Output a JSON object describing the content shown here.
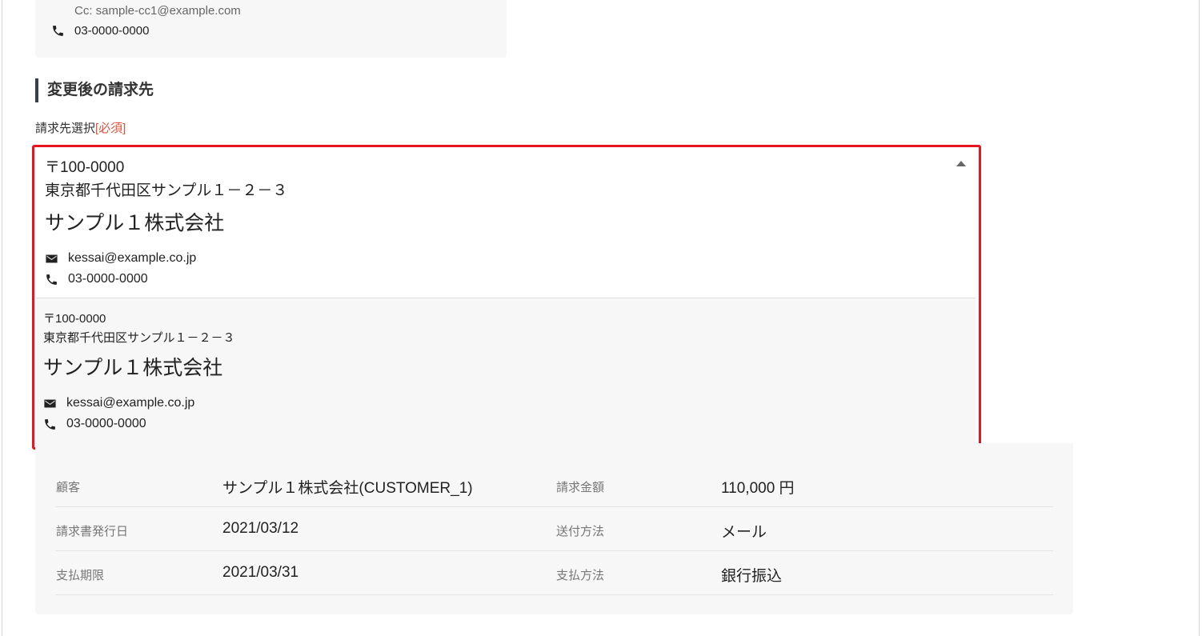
{
  "previous_billing": {
    "cc": "Cc: sample-cc1@example.com",
    "phone": "03-0000-0000"
  },
  "section": {
    "title": "変更後の請求先"
  },
  "billing_select": {
    "label": "請求先選択",
    "required": "[必須]",
    "selected": {
      "zip": "〒100-0000",
      "address": "東京都千代田区サンプル１－２－３",
      "company": "サンプル１株式会社",
      "email": "kessai@example.co.jp",
      "phone": "03-0000-0000"
    },
    "options": [
      {
        "zip": "〒100-0000",
        "address": "東京都千代田区サンプル１－２－３",
        "company": "サンプル１株式会社",
        "email": "kessai@example.co.jp",
        "phone": "03-0000-0000"
      }
    ]
  },
  "summary": {
    "rows": [
      {
        "k1": "顧客",
        "v1": "サンプル１株式会社(CUSTOMER_1)",
        "k2": "請求金額",
        "v2": "110,000 円"
      },
      {
        "k1": "請求書発行日",
        "v1": "2021/03/12",
        "k2": "送付方法",
        "v2": "メール"
      },
      {
        "k1": "支払期限",
        "v1": "2021/03/31",
        "k2": "支払方法",
        "v2": "銀行振込"
      }
    ]
  },
  "icons": {
    "phone": "phone-icon",
    "email": "envelope-icon",
    "caret": "caret-up-icon"
  },
  "colors": {
    "required": "#e0533d",
    "highlight_border": "#e8141e",
    "section_bar": "#3a3f45"
  }
}
